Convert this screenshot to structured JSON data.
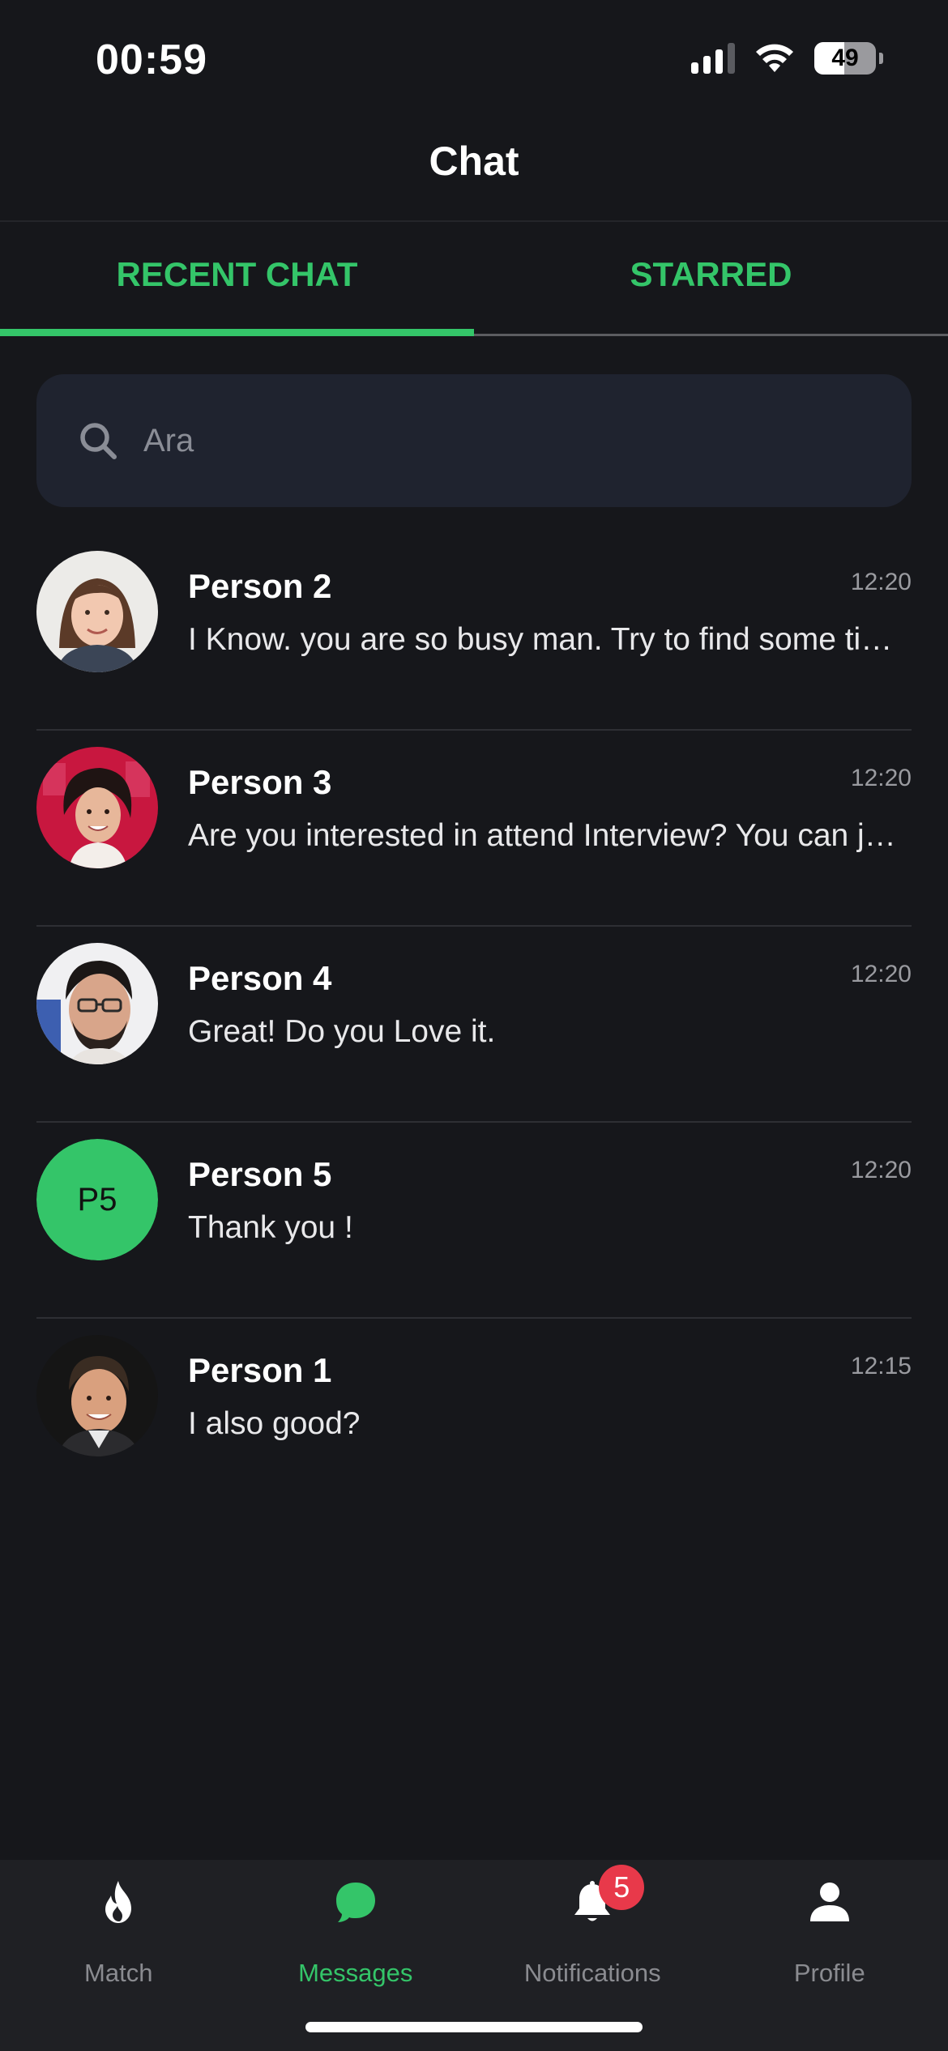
{
  "status_bar": {
    "time": "00:59",
    "battery": "49",
    "battery_level": 0.49
  },
  "header": {
    "title": "Chat"
  },
  "tabs": [
    {
      "label": "RECENT CHAT",
      "active": true
    },
    {
      "label": "STARRED",
      "active": false
    }
  ],
  "search": {
    "placeholder": "Ara",
    "icon": "search-icon"
  },
  "chats": [
    {
      "name": "Person 2",
      "time": "12:20",
      "preview": "I Know. you are so busy man. Try to find some time for me.",
      "avatar": "photo"
    },
    {
      "name": "Person 3",
      "time": "12:20",
      "preview": "Are you interested in attend Interview? You can join us.",
      "avatar": "photo"
    },
    {
      "name": "Person 4",
      "time": "12:20",
      "preview": "Great! Do you Love it.",
      "avatar": "photo"
    },
    {
      "name": "Person 5",
      "time": "12:20",
      "preview": "Thank you !",
      "avatar": "initials",
      "initials": "P5"
    },
    {
      "name": "Person 1",
      "time": "12:15",
      "preview": "I also good?",
      "avatar": "photo"
    }
  ],
  "bottom_nav": [
    {
      "label": "Match",
      "icon": "flame-icon",
      "active": false
    },
    {
      "label": "Messages",
      "icon": "chat-bubble-icon",
      "active": true
    },
    {
      "label": "Notifications",
      "icon": "bell-icon",
      "active": false,
      "badge": "5"
    },
    {
      "label": "Profile",
      "icon": "person-icon",
      "active": false
    }
  ],
  "colors": {
    "background": "#16171b",
    "accent": "#34c569",
    "search_bg": "#1f232f",
    "nav_bg": "#1f2024",
    "badge": "#e8394a"
  }
}
